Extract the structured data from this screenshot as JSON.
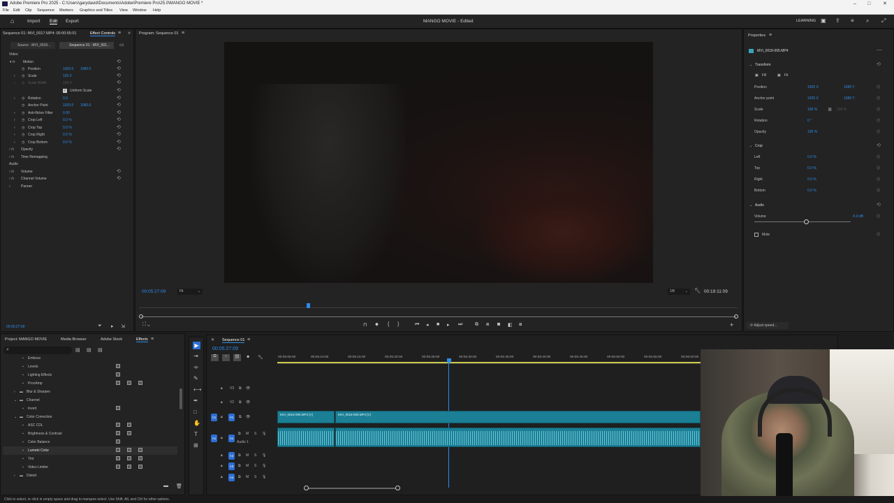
{
  "app": {
    "window_title": "Adobe Premiere Pro 2025 - C:\\Users\\garydavid\\Documents\\Adobe\\Premiere Pro\\25.0\\MANGO MOVIE *",
    "menu": [
      "File",
      "Edit",
      "Clip",
      "Sequence",
      "Markers",
      "Graphics and Titles",
      "View",
      "Window",
      "Help"
    ],
    "nav": {
      "import": "Import",
      "edit": "Edit",
      "export": "Export",
      "project_title": "MANGO MOVIE - Edited",
      "learning": "LEARNING"
    }
  },
  "effect_controls": {
    "panel_header": "Sequence 01: MVI_0017.MP4: 00:00:55:01",
    "tab": "Effect Controls",
    "source_tab": "Source - MVI_0018...",
    "sequence_tab": "Sequence 01 - MVI_001...",
    "section_video": "Video",
    "motion": "Motion",
    "position_label": "Position",
    "position_x": "1920.0",
    "position_y": "1080.0",
    "scale_label": "Scale",
    "scale_value": "100.0",
    "scale_width_label": "Scale Width",
    "scale_width_value": "100.0",
    "uniform_scale": "Uniform Scale",
    "rotation_label": "Rotation",
    "rotation_value": "0.0",
    "anchor_label": "Anchor Point",
    "anchor_x": "1920.0",
    "anchor_y": "1080.0",
    "antiflicker_label": "Anti-flicker Filter",
    "antiflicker_value": "0.00",
    "crop_left_label": "Crop Left",
    "crop_left_value": "0.0 %",
    "crop_top_label": "Crop Top",
    "crop_top_value": "0.0 %",
    "crop_right_label": "Crop Right",
    "crop_right_value": "0.0 %",
    "crop_bottom_label": "Crop Bottom",
    "crop_bottom_value": "0.0 %",
    "opacity": "Opacity",
    "time_remapping": "Time Remapping",
    "section_audio": "Audio",
    "volume": "Volume",
    "channel_volume": "Channel Volume",
    "panner": "Panner",
    "timecode": "00:05:27:09"
  },
  "program": {
    "title": "Program: Sequence 01",
    "timecode": "00:05:27:09",
    "fit": "Fit",
    "resolution": "1/8",
    "duration": "00:19:11:09"
  },
  "properties": {
    "title": "Properties",
    "clip": "MVI_0018-005.MP4",
    "transform": "Transform",
    "fill": "Fill",
    "fit": "Fit",
    "position_label": "Position",
    "position_x": "1920 X",
    "position_y": "1080 Y",
    "anchor_label": "Anchor point",
    "anchor_x": "1920 X",
    "anchor_y": "1080 Y",
    "scale_label": "Scale",
    "scale_value": "100 %",
    "scale_value2": "100 %",
    "rotation_label": "Rotation",
    "rotation_value": "0 °",
    "opacity_label": "Opacity",
    "opacity_value": "100 %",
    "crop": "Crop",
    "left_label": "Left",
    "left_value": "0.0 %",
    "top_label": "Top",
    "top_value": "0.0 %",
    "right_label": "Right",
    "right_value": "0.0 %",
    "bottom_label": "Bottom",
    "bottom_value": "0.0 %",
    "audio": "Audio",
    "volume_label": "Volume",
    "volume_value": "-5.9 dB",
    "mute": "Mute",
    "adjust_speed": "Adjust speed..."
  },
  "project": {
    "tabs": [
      "Project: MANGO MOVIE",
      "Media Browser",
      "Adobe Stock",
      "Effects"
    ],
    "items": [
      "Emboss",
      "Levels",
      "Lighting Effects",
      "ProcAmp",
      "Blur & Sharpen",
      "Channel",
      "Invert",
      "Color Correction",
      "ASC CDL",
      "Brightness & Contrast",
      "Color Balance",
      "Lumetri Color",
      "Tint",
      "Video Limiter",
      "Distort"
    ]
  },
  "timeline": {
    "tab": "Sequence 01",
    "timecode": "00:05:27:09",
    "ruler": [
      "00:05:05:00",
      "00:05:10:00",
      "00:05:15:00",
      "00:05:20:00",
      "00:05:25:00",
      "00:05:30:00",
      "00:05:35:00",
      "00:05:40:00",
      "00:05:45:00",
      "00:05:50:00",
      "00:05:55:00",
      "00:06:00:00"
    ],
    "tracks": {
      "v3": "V3",
      "v2": "V2",
      "v1": "V1",
      "a1": "A1",
      "a2": "A2",
      "a3": "A3",
      "a4": "A4",
      "audio1": "Audio 1"
    },
    "clip1": "MVI_0016-005.MP4 [V]",
    "clip2": "MVI_0018-005.MP4 [V]"
  },
  "status": "Click to select, or click in empty space and drag to marquee select. Use Shift, Alt, and Ctrl for other options."
}
